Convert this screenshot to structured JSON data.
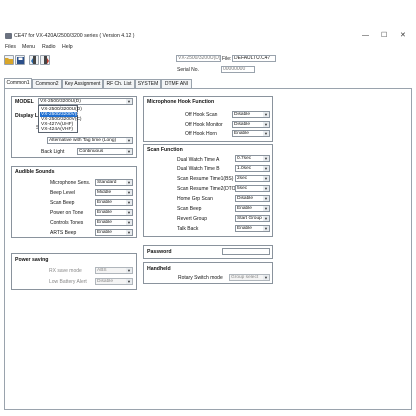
{
  "window": {
    "title": "CE47 for VX-420A/2500/3200 series ( Version 4.12 )",
    "controls": {
      "minimize": "—",
      "maximize": "☐",
      "close": "✕"
    }
  },
  "menu": [
    "Files",
    "Menu",
    "Radio",
    "Help"
  ],
  "toolbar": {
    "buttons": [
      "open-icon",
      "save-icon",
      "read-radio-icon",
      "write-radio-icon"
    ]
  },
  "radio_info": {
    "model_value": "VX-2500/3200U(D)",
    "file_label": "File:",
    "file_value": "DEFAULTU.C47",
    "serial_label": "Serial No.",
    "serial_value": "00000000"
  },
  "tabs": [
    "Common1",
    "Common2",
    "Key Assignment",
    "RF Ch. List",
    "SYSTEM",
    "DTMF ANI"
  ],
  "active_tab": "Common1",
  "model": {
    "label": "MODEL",
    "value": "VX-2500/3200U(D)",
    "options": [
      "VX-2500/3200U(D)",
      "VX-2500/3200V(D)",
      "VX-2500/3200V(C)",
      "VX-427A(UHF)",
      "VX-424A(VHF)"
    ],
    "highlighted_index": 1
  },
  "display": {
    "label_prefix": "Display L",
    "sub_prefix": "S",
    "alt_value": "Alternative with Tag time (Long)",
    "back_light_label": "Back Light",
    "back_light_value": "Continuous"
  },
  "audible": {
    "title": "Audible Sounds",
    "rows": [
      {
        "label": "Microphone Sens.",
        "value": "Standard"
      },
      {
        "label": "Beep Level",
        "value": "Middle"
      },
      {
        "label": "Scan Beep",
        "value": "Enable"
      },
      {
        "label": "Power on Tone",
        "value": "Enable"
      },
      {
        "label": "Controls Tones",
        "value": "Enable"
      },
      {
        "label": "ARTS Beep",
        "value": "Enable"
      }
    ]
  },
  "power_saving": {
    "title": "Power saving",
    "rows": [
      {
        "label": "RX save mode",
        "value": "ABS"
      },
      {
        "label": "Low Battery Alert",
        "value": "Disable"
      }
    ]
  },
  "hook": {
    "title": "Microphone Hook Function",
    "rows": [
      {
        "label": "Off Hook Scan",
        "value": "Disable"
      },
      {
        "label": "Off Hook Monitor",
        "value": "Disable"
      },
      {
        "label": "Off Hook Horn",
        "value": "Enable"
      }
    ]
  },
  "scan": {
    "title": "Scan Function",
    "rows": [
      {
        "label": "Dual Watch Time A",
        "value": "0.7sec"
      },
      {
        "label": "Dual Watch Time B",
        "value": "1.0sec"
      },
      {
        "label": "Scan Resume Time1(BS)",
        "value": "2sec"
      },
      {
        "label": "Scan Resume Time2(DTO)",
        "value": "5sec"
      },
      {
        "label": "Home Grp Scan",
        "value": "Disable"
      },
      {
        "label": "Scan Beep",
        "value": "Enable"
      },
      {
        "label": "Revert Group",
        "value": "Start Group"
      },
      {
        "label": "Talk Back",
        "value": "Enable"
      }
    ]
  },
  "password": {
    "label": "Password",
    "value": ""
  },
  "handheld": {
    "title": "Handheld",
    "label": "Rotary Switch mode",
    "value": "Group select"
  }
}
